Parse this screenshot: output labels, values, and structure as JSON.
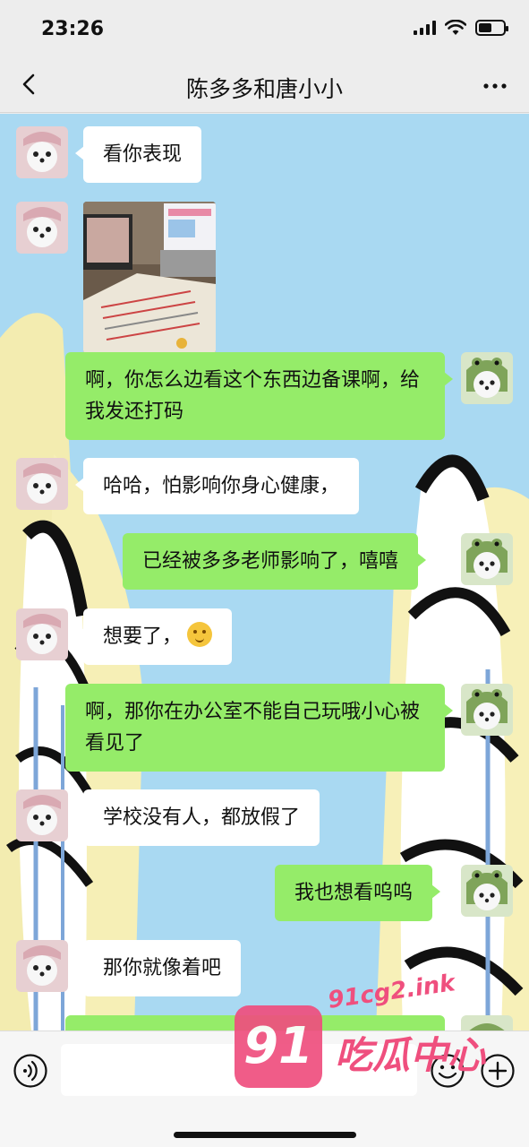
{
  "status_bar": {
    "time": "23:26"
  },
  "nav": {
    "title": "陈多多和唐小小"
  },
  "messages": [
    {
      "side": "left",
      "text": "看你表现"
    },
    {
      "side": "left",
      "type": "image"
    },
    {
      "side": "right",
      "text": "啊，你怎么边看这个东西边备课啊，给我发还打码"
    },
    {
      "side": "left",
      "text": "哈哈，怕影响你身心健康，"
    },
    {
      "side": "right",
      "text": "已经被多多老师影响了，嘻嘻"
    },
    {
      "side": "left",
      "text": "想要了，"
    },
    {
      "side": "right",
      "text": "啊，那你在办公室不能自己玩哦小心被看见了"
    },
    {
      "side": "left",
      "text": "学校没有人，都放假了"
    },
    {
      "side": "right",
      "text": "我也想看呜呜"
    },
    {
      "side": "left",
      "text": "那你就像着吧"
    }
  ],
  "emoji": "thinking-face",
  "watermark": {
    "url": "91cg2.ink",
    "badge": "91",
    "name": "吃瓜中心"
  },
  "colors": {
    "right_bubble": "#95ec69",
    "left_bubble": "#ffffff",
    "watermark": "#ef4f7e"
  }
}
